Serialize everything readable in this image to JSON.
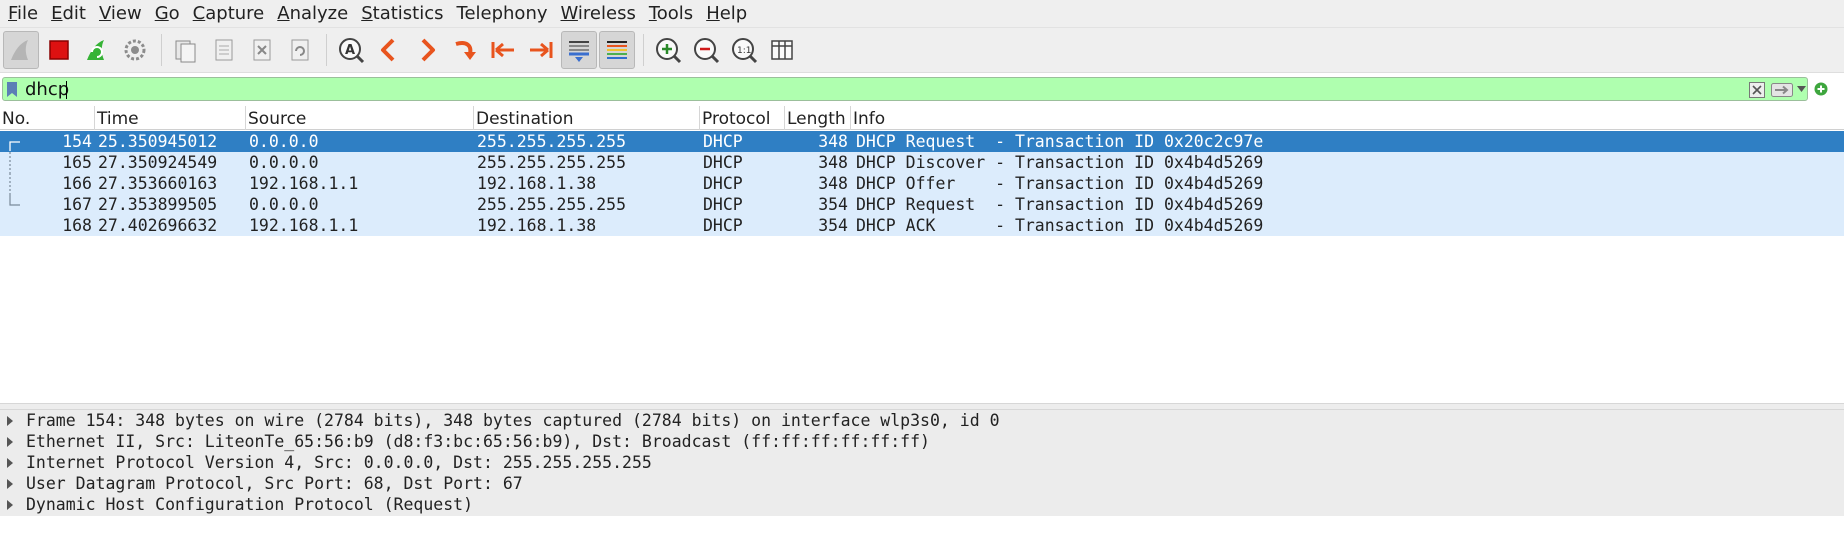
{
  "menubar": {
    "items": [
      {
        "accel": "F",
        "rest": "ile"
      },
      {
        "accel": "E",
        "rest": "dit"
      },
      {
        "accel": "V",
        "rest": "iew"
      },
      {
        "accel": "G",
        "rest": "o"
      },
      {
        "accel": "C",
        "rest": "apture"
      },
      {
        "accel": "A",
        "rest": "nalyze"
      },
      {
        "accel": "S",
        "rest": "tatistics"
      },
      {
        "accel": "",
        "rest": "Telephony",
        "pre": ""
      },
      {
        "accel": "W",
        "rest": "ireless"
      },
      {
        "accel": "T",
        "rest": "ools"
      },
      {
        "accel": "H",
        "rest": "elp"
      }
    ]
  },
  "filter": {
    "value": "dhcp"
  },
  "packet_list": {
    "columns": [
      "No.",
      "Time",
      "Source",
      "Destination",
      "Protocol",
      "Length",
      "Info"
    ],
    "rows": [
      {
        "no": "154",
        "time": "25.350945012",
        "src": "0.0.0.0",
        "dst": "255.255.255.255",
        "proto": "DHCP",
        "len": "348",
        "info": "DHCP Request  - Transaction ID 0x20c2c97e"
      },
      {
        "no": "165",
        "time": "27.350924549",
        "src": "0.0.0.0",
        "dst": "255.255.255.255",
        "proto": "DHCP",
        "len": "348",
        "info": "DHCP Discover - Transaction ID 0x4b4d5269"
      },
      {
        "no": "166",
        "time": "27.353660163",
        "src": "192.168.1.1",
        "dst": "192.168.1.38",
        "proto": "DHCP",
        "len": "348",
        "info": "DHCP Offer    - Transaction ID 0x4b4d5269"
      },
      {
        "no": "167",
        "time": "27.353899505",
        "src": "0.0.0.0",
        "dst": "255.255.255.255",
        "proto": "DHCP",
        "len": "354",
        "info": "DHCP Request  - Transaction ID 0x4b4d5269"
      },
      {
        "no": "168",
        "time": "27.402696632",
        "src": "192.168.1.1",
        "dst": "192.168.1.38",
        "proto": "DHCP",
        "len": "354",
        "info": "DHCP ACK      - Transaction ID 0x4b4d5269"
      }
    ]
  },
  "details": {
    "items": [
      "Frame 154: 348 bytes on wire (2784 bits), 348 bytes captured (2784 bits) on interface wlp3s0, id 0",
      "Ethernet II, Src: LiteonTe_65:56:b9 (d8:f3:bc:65:56:b9), Dst: Broadcast (ff:ff:ff:ff:ff:ff)",
      "Internet Protocol Version 4, Src: 0.0.0.0, Dst: 255.255.255.255",
      "User Datagram Protocol, Src Port: 68, Dst Port: 67",
      "Dynamic Host Configuration Protocol (Request)"
    ]
  },
  "colors": {
    "filter_valid_bg": "#afffaf",
    "selected_row_bg": "#2f7fc4",
    "row_bg": "#dcecfc",
    "accent_orange": "#e8541e"
  },
  "toolbar": {
    "icons": [
      "shark-fin-start-icon",
      "stop-capture-icon",
      "restart-capture-icon",
      "capture-options-icon",
      "open-file-icon",
      "save-file-icon",
      "close-file-icon",
      "reload-file-icon",
      "find-packet-icon",
      "go-back-icon",
      "go-forward-icon",
      "go-to-packet-icon",
      "first-packet-icon",
      "last-packet-icon",
      "auto-scroll-icon",
      "colorize-icon",
      "zoom-in-icon",
      "zoom-out-icon",
      "normal-size-icon",
      "resize-columns-icon"
    ]
  }
}
